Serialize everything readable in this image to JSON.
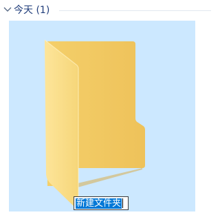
{
  "group": {
    "title": "今天 (1)",
    "expanded": true
  },
  "items": [
    {
      "name": "新建文件夹",
      "type": "folder",
      "icon": "folder-icon",
      "state": "renaming",
      "name_selected": true
    }
  ],
  "colors": {
    "selection_background": "#cce8ff",
    "text_selection": "#0078d7",
    "folder_front": "#f8d775",
    "folder_back": "#e9bc4d",
    "group_title": "#1f3c7a"
  }
}
